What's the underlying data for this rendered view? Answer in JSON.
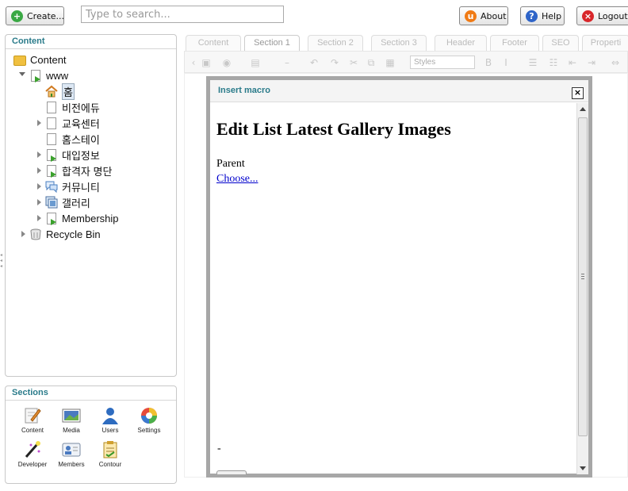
{
  "header": {
    "create_label": "Create...",
    "search_placeholder": "Type to search...",
    "about_label": "About",
    "help_label": "Help",
    "logout_label": "Logout: A"
  },
  "content_panel": {
    "title": "Content",
    "tree": [
      {
        "label": "Content",
        "icon": "folder-icon"
      },
      {
        "label": "www",
        "icon": "document-publish-icon"
      },
      {
        "label": "홈",
        "icon": "home-icon"
      },
      {
        "label": "비전에듀",
        "icon": "document-icon"
      },
      {
        "label": "교육센터",
        "icon": "document-icon"
      },
      {
        "label": "홈스테이",
        "icon": "document-icon"
      },
      {
        "label": "대입정보",
        "icon": "document-publish-icon"
      },
      {
        "label": "합격자 명단",
        "icon": "document-publish-icon"
      },
      {
        "label": "커뮤니티",
        "icon": "chat-icon"
      },
      {
        "label": "갤러리",
        "icon": "gallery-icon"
      },
      {
        "label": "Membership",
        "icon": "document-publish-icon"
      },
      {
        "label": "Recycle Bin",
        "icon": "recycle-bin-icon"
      }
    ]
  },
  "sections_panel": {
    "title": "Sections",
    "items": [
      {
        "label": "Content",
        "icon": "content-icon"
      },
      {
        "label": "Media",
        "icon": "media-icon"
      },
      {
        "label": "Users",
        "icon": "users-icon"
      },
      {
        "label": "Settings",
        "icon": "settings-icon"
      },
      {
        "label": "Developer",
        "icon": "developer-icon"
      },
      {
        "label": "Members",
        "icon": "members-icon"
      },
      {
        "label": "Contour",
        "icon": "contour-icon"
      }
    ]
  },
  "editor": {
    "tabs": [
      "Content",
      "Section 1",
      "Section 2",
      "Section 3",
      "Header",
      "Footer",
      "SEO",
      "Properti"
    ],
    "styles_label": "Styles"
  },
  "modal": {
    "title": "Insert macro",
    "heading": "Edit List Latest Gallery Images",
    "parent_label": "Parent",
    "choose_link": "Choose...",
    "dash": "-"
  },
  "colors": {
    "accent": "#2a7b8a",
    "link": "#0000cc",
    "modal_border": "#a7a7a7"
  }
}
